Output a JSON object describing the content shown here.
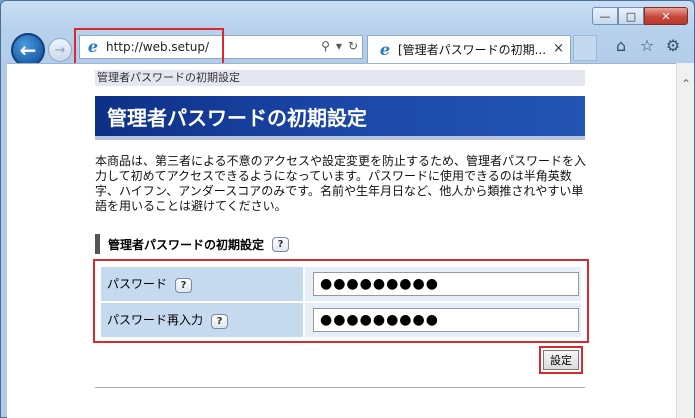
{
  "browser": {
    "address": "http://web.setup/",
    "tab_title": "[管理者パスワードの初期...",
    "tab_close": "×",
    "caption": {
      "minimize": "—",
      "maximize": "□",
      "close": "✕"
    }
  },
  "page": {
    "breadcrumb": "管理者パスワードの初期設定",
    "banner_title": "管理者パスワードの初期設定",
    "description": "本商品は、第三者による不意のアクセスや設定変更を防止するため、管理者パスワードを入力して初めてアクセスできるようになっています。パスワードに使用できるのは半角英数字、ハイフン、アンダースコアのみです。名前や生年月日など、他人から類推されやすい単語を用いることは避けてください。",
    "section_title": "管理者パスワードの初期設定",
    "help_label": "?",
    "fields": [
      {
        "label": "パスワード",
        "value": "●●●●●●●●●"
      },
      {
        "label": "パスワード再入力",
        "value": "●●●●●●●●●"
      }
    ],
    "submit_label": "設定"
  }
}
